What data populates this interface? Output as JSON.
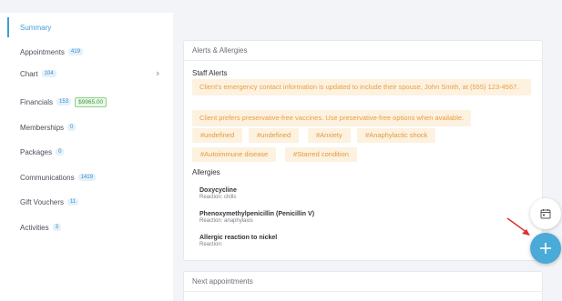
{
  "sidebar": {
    "items": [
      {
        "label": "Summary",
        "badge": "",
        "active": true
      },
      {
        "label": "Appointments",
        "badge": "419"
      },
      {
        "label": "Chart",
        "badge": "104"
      },
      {
        "label": "Financials",
        "badge": "153",
        "amount": "$9965.00"
      },
      {
        "label": "Memberships",
        "badge": "0"
      },
      {
        "label": "Packages",
        "badge": "0"
      },
      {
        "label": "Communications",
        "badge": "1419"
      },
      {
        "label": "Gift Vouchers",
        "badge": "11"
      },
      {
        "label": "Activities",
        "badge": "3"
      }
    ],
    "chevron_icon": "chevron-right-icon"
  },
  "alerts_card": {
    "title": "Alerts & Allergies",
    "staff_alerts_title": "Staff Alerts",
    "alerts": [
      "Client's emergency contact information is updated to include their spouse, John Smith, at (555) 123-4567.",
      "Client prefers preservative-free vaccines. Use preservative-free options when available."
    ],
    "tags": [
      "#undefined",
      "#undefined",
      "#Anxiety",
      "#Anaphylactic shock",
      "#Autoimmune disease",
      "#Starred condition"
    ],
    "allergies_title": "Allergies",
    "allergies": [
      {
        "name": "Doxycycline",
        "reaction": "Reaction: chills"
      },
      {
        "name": "Phenoxymethylpenicillin (Penicillin V)",
        "reaction": "Reaction: anaphylaxis"
      },
      {
        "name": "Allergic reaction to nickel",
        "reaction": "Reaction:"
      }
    ]
  },
  "next_card": {
    "title": "Next appointments"
  },
  "fabs": {
    "calendar_icon": "calendar-icon",
    "add_icon": "plus-icon"
  },
  "colors": {
    "accent": "#3aa0d6",
    "alert_bg": "#fdf1e0",
    "alert_text": "#e8a040",
    "fab": "#4aaad8",
    "arrow": "#e03030"
  }
}
